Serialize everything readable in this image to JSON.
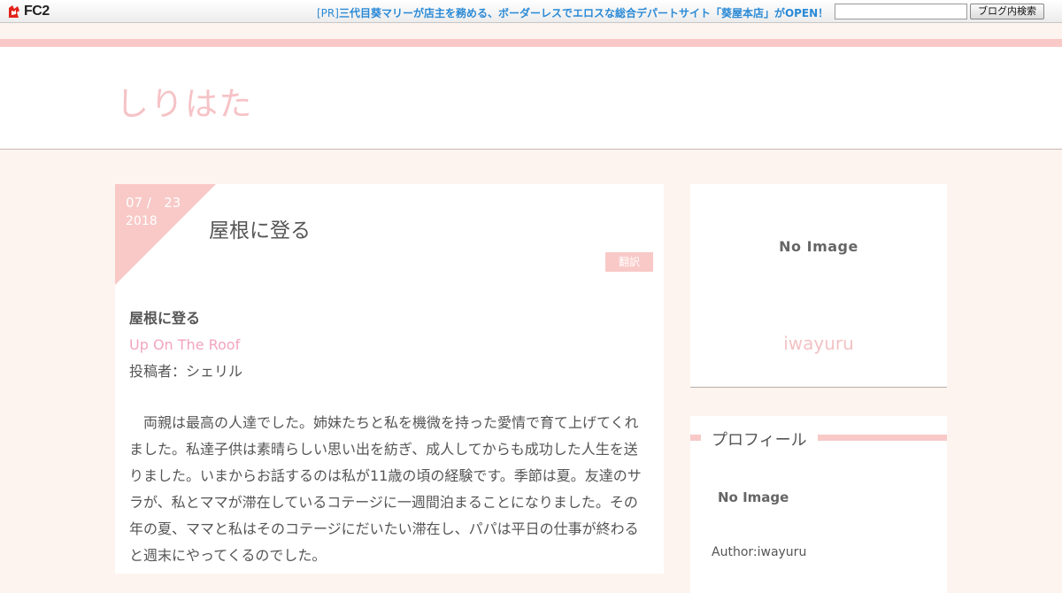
{
  "fc2bar": {
    "logo_text": "FC2",
    "pr_prefix": "[PR]",
    "pr_text": "三代目葵マリーが店主を務める、ボーダーレスでエロスな総合デパートサイト「葵屋本店」がOPEN！",
    "search_placeholder": "",
    "search_button": "ブログ内検索"
  },
  "blog": {
    "title": "しりはた"
  },
  "article": {
    "date_md": "07 /   23",
    "date_year": "2018",
    "title": "屋根に登る",
    "translate_label": "翻訳",
    "heading": "屋根に登る",
    "english_title": "Up On The Roof",
    "author_line": "投稿者：シェリル",
    "paragraph": "　両親は最高の人達でした。姉妹たちと私を機微を持った愛情で育て上げてくれました。私達子供は素晴らしい思い出を紡ぎ、成人してからも成功した人生を送りました。いまからお話するのは私が11歳の頃の経験です。季節は夏。友達のサラが、私とママが滞在しているコテージに一週間泊まることになりました。その年の夏、ママと私はそのコテージにだいたい滞在し、パパは平日の仕事が終わると週末にやってくるのでした。"
  },
  "sidebar": {
    "no_image": "No Image",
    "author_name": "iwayuru",
    "profile_title": "プロフィール",
    "profile_no_image": "No Image",
    "author_label": "Author:iwayuru"
  },
  "colors": {
    "accent_pink": "#f8c9c7",
    "link_blue": "#2a8ad6",
    "link_pink": "#f2a4c0",
    "background": "#fdf4f0"
  }
}
